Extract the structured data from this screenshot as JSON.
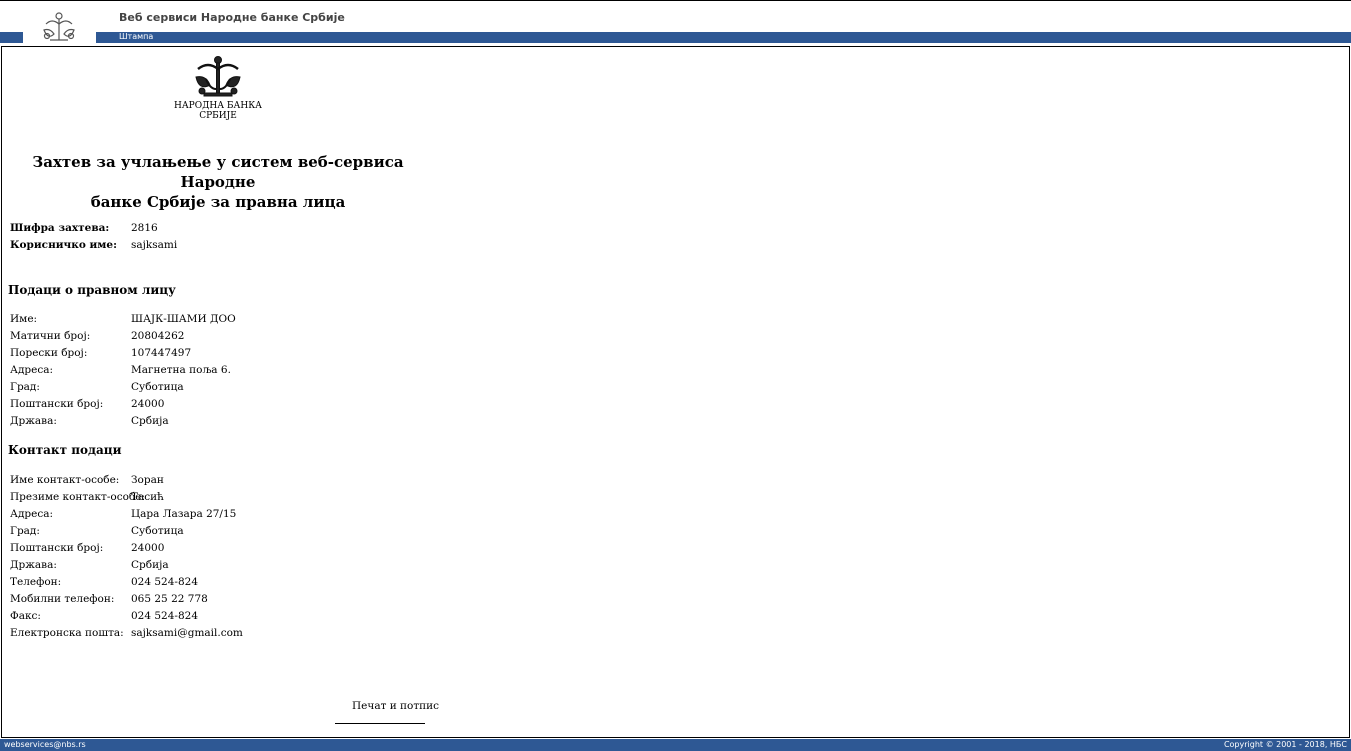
{
  "header": {
    "title": "Веб сервиси Народне банке Србије",
    "nav_print": "Штампа"
  },
  "logo": {
    "line1": "НАРОДНА БАНКА",
    "line2": "СРБИЈЕ"
  },
  "document": {
    "title_line1": "Захтев за учлањење у систем веб-сервиса Народне",
    "title_line2": "банке Србије за правна лица"
  },
  "request": [
    {
      "label": "Шифра захтева:",
      "value": "2816"
    },
    {
      "label": "Корисничко име:",
      "value": "sajksami"
    }
  ],
  "legal_entity": {
    "heading": "Подаци о правном лицу",
    "fields": [
      {
        "label": "Име:",
        "value": "ШАЈК-ШАМИ ДОО"
      },
      {
        "label": "Матични број:",
        "value": "20804262"
      },
      {
        "label": "Порески број:",
        "value": "107447497"
      },
      {
        "label": "Адреса:",
        "value": "Магнетна поља 6."
      },
      {
        "label": "Град:",
        "value": "Суботица"
      },
      {
        "label": "Поштански број:",
        "value": "24000"
      },
      {
        "label": "Држава:",
        "value": "Србија"
      }
    ]
  },
  "contact": {
    "heading": "Контакт подаци",
    "fields": [
      {
        "label": "Име контакт-особе:",
        "value": "Зоран"
      },
      {
        "label": "Презиме контакт-особе:",
        "value": "Тасић"
      },
      {
        "label": "Адреса:",
        "value": "Цара Лазара 27/15"
      },
      {
        "label": "Град:",
        "value": "Суботица"
      },
      {
        "label": "Поштански број:",
        "value": "24000"
      },
      {
        "label": "Држава:",
        "value": "Србија"
      },
      {
        "label": "Телефон:",
        "value": "024 524-824"
      },
      {
        "label": "Мобилни телефон:",
        "value": "065 25 22 778"
      },
      {
        "label": "Факс:",
        "value": "024 524-824"
      },
      {
        "label": "Електронска пошта:",
        "value": "sajksami@gmail.com"
      }
    ]
  },
  "signature": {
    "label": "Печат и потпис"
  },
  "footer": {
    "email": "webservices@nbs.rs",
    "copyright": "Copyright © 2001 - 2018, НБС"
  },
  "colors": {
    "bar": "#2e5894"
  }
}
